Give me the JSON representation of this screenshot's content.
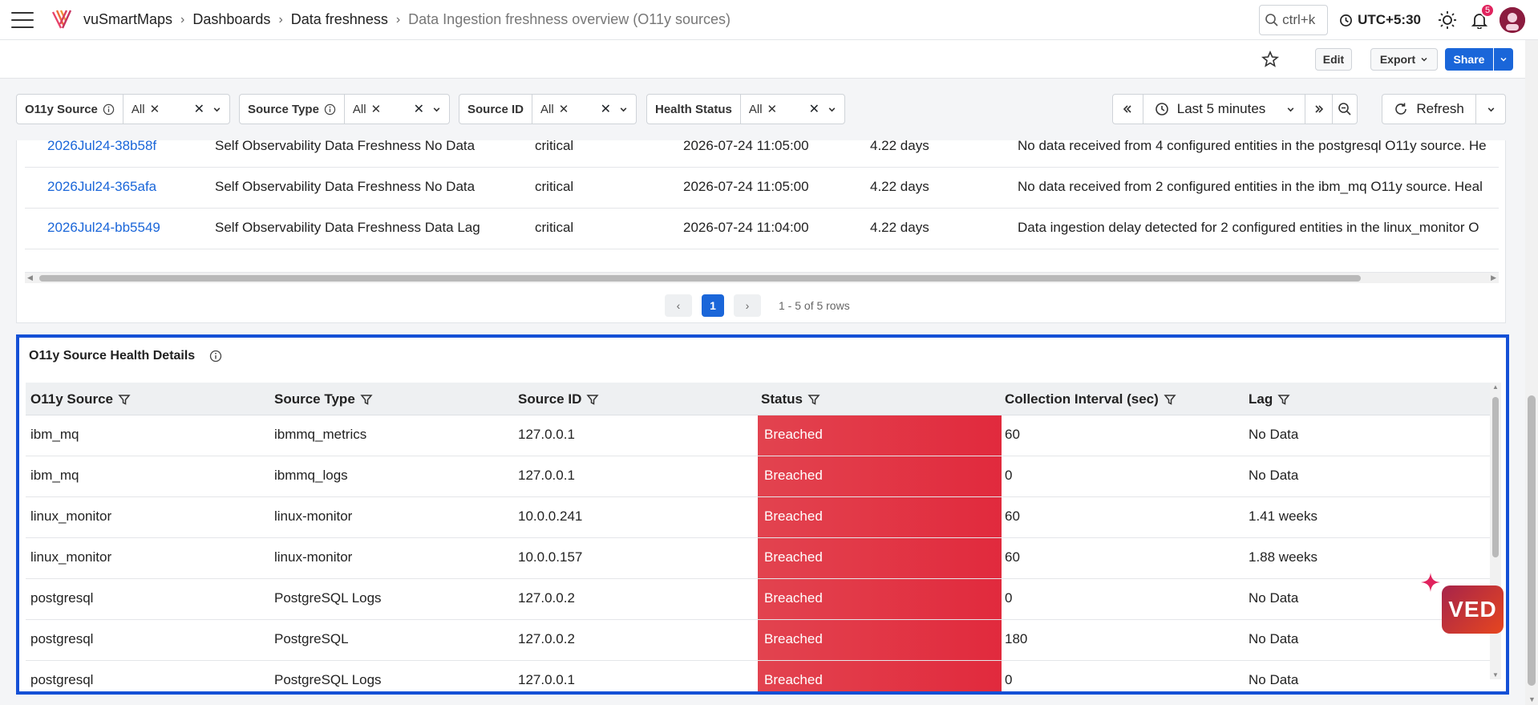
{
  "topbar": {
    "breadcrumbs": [
      "vuSmartMaps",
      "Dashboards",
      "Data freshness",
      "Data Ingestion freshness overview (O11y sources)"
    ],
    "search_shortcut": "ctrl+k",
    "timezone": "UTC+5:30",
    "notification_count": "5"
  },
  "actionbar": {
    "edit_label": "Edit",
    "export_label": "Export",
    "share_label": "Share"
  },
  "filters": [
    {
      "label": "O11y Source",
      "value": "All"
    },
    {
      "label": "Source Type",
      "value": "All"
    },
    {
      "label": "Source ID",
      "value": "All"
    },
    {
      "label": "Health Status",
      "value": "All"
    }
  ],
  "timepicker": {
    "range_label": "Last 5 minutes",
    "refresh_label": "Refresh"
  },
  "alerts": {
    "rows": [
      {
        "id": "2026Jul24-38b58f",
        "name": "Self Observability Data Freshness No Data",
        "severity": "critical",
        "time": "2026-07-24 11:05:00",
        "duration": "4.22 days",
        "summary": "No data received from 4 configured entities in the postgresql O11y source. He"
      },
      {
        "id": "2026Jul24-365afa",
        "name": "Self Observability Data Freshness No Data",
        "severity": "critical",
        "time": "2026-07-24 11:05:00",
        "duration": "4.22 days",
        "summary": "No data received from 2 configured entities in the ibm_mq O11y source. Heal"
      },
      {
        "id": "2026Jul24-bb5549",
        "name": "Self Observability Data Freshness Data Lag",
        "severity": "critical",
        "time": "2026-07-24 11:04:00",
        "duration": "4.22 days",
        "summary": "Data ingestion delay detected for 2 configured entities in the linux_monitor O"
      }
    ],
    "pager": {
      "current_page": "1",
      "summary": "1 - 5 of 5 rows"
    }
  },
  "health": {
    "title": "O11y Source Health Details",
    "columns": [
      "O11y Source",
      "Source Type",
      "Source ID",
      "Status",
      "Collection Interval (sec)",
      "Lag"
    ],
    "rows": [
      [
        "ibm_mq",
        "ibmmq_metrics",
        "127.0.0.1",
        "Breached",
        "60",
        "No Data"
      ],
      [
        "ibm_mq",
        "ibmmq_logs",
        "127.0.0.1",
        "Breached",
        "0",
        "No Data"
      ],
      [
        "linux_monitor",
        "linux-monitor",
        "10.0.0.241",
        "Breached",
        "60",
        "1.41 weeks"
      ],
      [
        "linux_monitor",
        "linux-monitor",
        "10.0.0.157",
        "Breached",
        "60",
        "1.88 weeks"
      ],
      [
        "postgresql",
        "PostgreSQL Logs",
        "127.0.0.2",
        "Breached",
        "0",
        "No Data"
      ],
      [
        "postgresql",
        "PostgreSQL",
        "127.0.0.2",
        "Breached",
        "180",
        "No Data"
      ],
      [
        "postgresql",
        "PostgreSQL Logs",
        "127.0.0.1",
        "Breached",
        "0",
        "No Data"
      ]
    ]
  },
  "assistant": {
    "label": "VED"
  },
  "colors": {
    "accent": "#1a66d9",
    "breached": "#e12a3d",
    "highlight_border": "#1450d6"
  }
}
